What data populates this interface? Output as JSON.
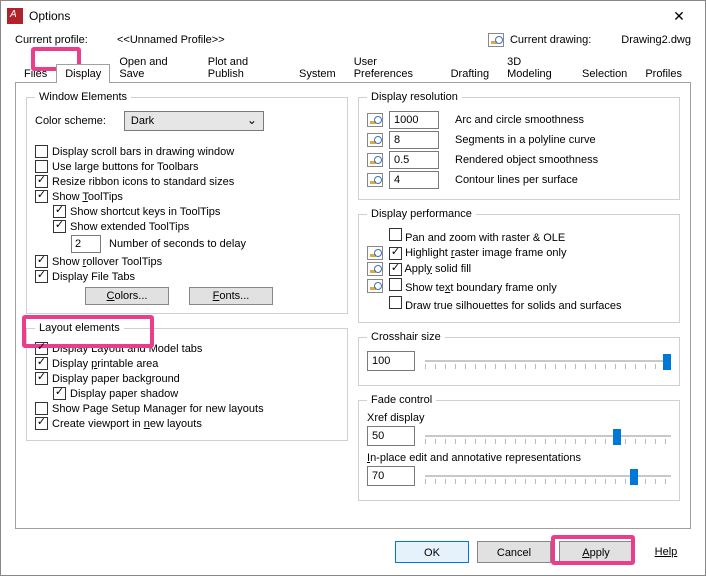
{
  "window": {
    "title": "Options"
  },
  "profile": {
    "label": "Current profile:",
    "value": "<<Unnamed Profile>>",
    "drawing_label": "Current drawing:",
    "drawing_value": "Drawing2.dwg"
  },
  "tabs": [
    "Files",
    "Display",
    "Open and Save",
    "Plot and Publish",
    "System",
    "User Preferences",
    "Drafting",
    "3D Modeling",
    "Selection",
    "Profiles"
  ],
  "left": {
    "window_elements": {
      "legend": "Window Elements",
      "color_scheme_label": "Color scheme:",
      "color_scheme_value": "Dark",
      "scrollbars": "Display scroll bars in drawing window",
      "large_buttons": "Use large buttons for Toolbars",
      "resize_ribbon": "Resize ribbon icons to standard sizes",
      "show_tooltips": "Show ToolTips",
      "shortcut_keys": "Show shortcut keys in ToolTips",
      "extended_tt": "Show extended ToolTips",
      "delay_value": "2",
      "delay_label": "Number of seconds to delay",
      "rollover_tt": "Show rollover ToolTips",
      "file_tabs": "Display File Tabs",
      "colors_btn": "Colors...",
      "fonts_btn": "Fonts..."
    },
    "layout_elements": {
      "legend": "Layout elements",
      "layout_tabs": "Display Layout and Model tabs",
      "printable": "Display printable area",
      "paper_bg": "Display paper background",
      "paper_shadow": "Display paper shadow",
      "page_setup": "Show Page Setup Manager for new layouts",
      "viewport": "Create viewport in new layouts"
    }
  },
  "right": {
    "display_resolution": {
      "legend": "Display resolution",
      "rows": [
        {
          "value": "1000",
          "label": "Arc and circle smoothness"
        },
        {
          "value": "8",
          "label": "Segments in a polyline curve"
        },
        {
          "value": "0.5",
          "label": "Rendered object smoothness"
        },
        {
          "value": "4",
          "label": "Contour lines per surface"
        }
      ]
    },
    "display_performance": {
      "legend": "Display performance",
      "pan_zoom": "Pan and zoom with raster & OLE",
      "highlight_raster": "Highlight raster image frame only",
      "solid_fill": "Apply solid fill",
      "text_boundary": "Show text boundary frame only",
      "silhouettes": "Draw true silhouettes for solids and surfaces"
    },
    "crosshair": {
      "legend": "Crosshair size",
      "value": "100"
    },
    "fade": {
      "legend": "Fade control",
      "xref_label": "Xref display",
      "xref_value": "50",
      "inplace_label": "In-place edit and annotative representations",
      "inplace_value": "70"
    }
  },
  "footer": {
    "ok": "OK",
    "cancel": "Cancel",
    "apply": "Apply",
    "help": "Help"
  }
}
